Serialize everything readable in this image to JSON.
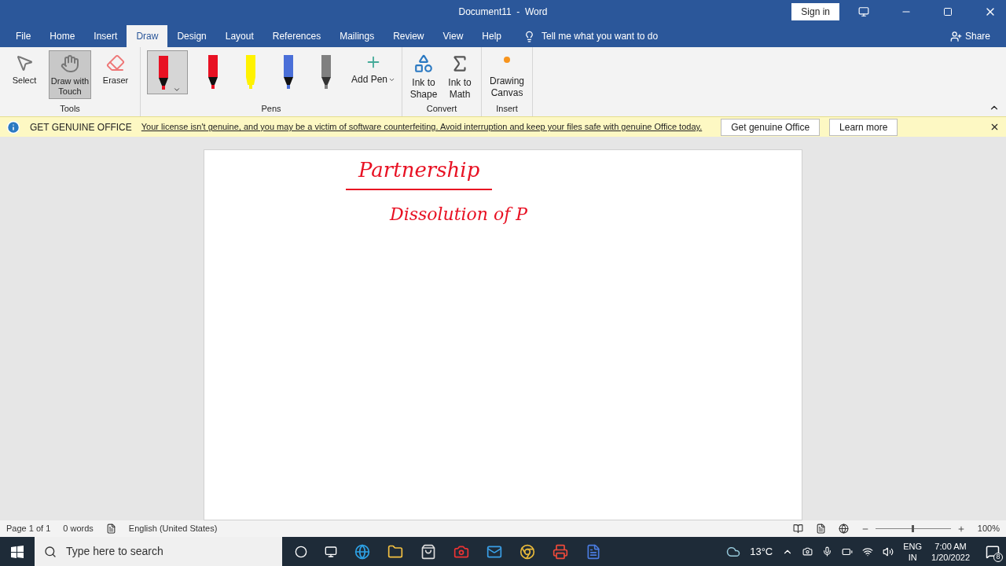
{
  "window": {
    "title": "Document11  -  Word",
    "sign_in": "Sign in"
  },
  "tabs": [
    {
      "label": "File",
      "selected": false
    },
    {
      "label": "Home",
      "selected": false
    },
    {
      "label": "Insert",
      "selected": false
    },
    {
      "label": "Draw",
      "selected": true
    },
    {
      "label": "Design",
      "selected": false
    },
    {
      "label": "Layout",
      "selected": false
    },
    {
      "label": "References",
      "selected": false
    },
    {
      "label": "Mailings",
      "selected": false
    },
    {
      "label": "Review",
      "selected": false
    },
    {
      "label": "View",
      "selected": false
    },
    {
      "label": "Help",
      "selected": false
    }
  ],
  "tell_me": "Tell me what you want to do",
  "share": "Share",
  "ribbon": {
    "tools": {
      "label": "Tools",
      "items": [
        {
          "kind": "select",
          "label": "Select",
          "selected": false
        },
        {
          "kind": "touch",
          "label": "Draw with Touch",
          "selected": true
        },
        {
          "kind": "eraser",
          "label": "Eraser",
          "selected": false
        }
      ]
    },
    "pens": {
      "label": "Pens",
      "items": [
        {
          "kind": "pen",
          "color": "#e81123",
          "selected": true
        },
        {
          "kind": "pen",
          "color": "#e81123",
          "selected": false
        },
        {
          "kind": "highlighter",
          "color": "#fff200",
          "selected": false
        },
        {
          "kind": "pen",
          "color": "#4a6fd8",
          "selected": false
        },
        {
          "kind": "pencil",
          "color": "#808080",
          "selected": false
        }
      ],
      "add_pen": "Add Pen"
    },
    "convert": {
      "label": "Convert",
      "items": [
        "Ink to Shape",
        "Ink to Math"
      ]
    },
    "insert": {
      "label": "Insert",
      "items": [
        "Drawing Canvas"
      ]
    }
  },
  "notice": {
    "title": "GET GENUINE OFFICE",
    "message": "Your license isn't genuine, and you may be a victim of software counterfeiting. Avoid interruption and keep your files safe with genuine Office today.",
    "buttons": [
      "Get genuine Office",
      "Learn more"
    ]
  },
  "document": {
    "ink": [
      {
        "kind": "heading",
        "text": "Partnership"
      },
      {
        "kind": "line",
        "text": "Dissolution of P"
      }
    ]
  },
  "status_bar": {
    "page": "Page 1 of 1",
    "words": "0 words",
    "language": "English (United States)",
    "zoom": "100%",
    "level": 0.5
  },
  "taskbar": {
    "search_placeholder": "Type here to search",
    "temperature": "13°C",
    "language": "ENG",
    "region": "IN",
    "time": "7:00 AM",
    "date": "1/20/2022",
    "notifications": "8"
  }
}
